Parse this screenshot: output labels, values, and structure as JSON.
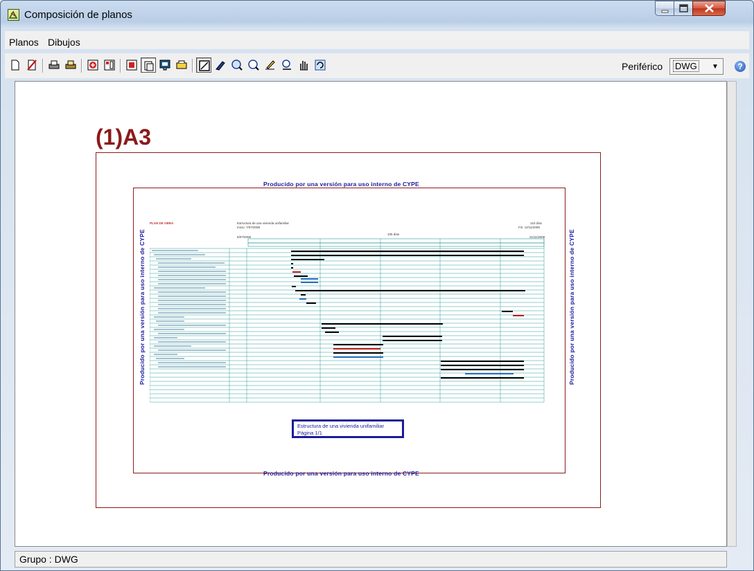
{
  "window": {
    "title": "Composición de planos"
  },
  "menu": {
    "items": [
      "Planos",
      "Dibujos"
    ]
  },
  "toolbar": {
    "buttons": [
      {
        "name": "new-icon"
      },
      {
        "name": "delete-icon"
      },
      {
        "name": "print-icon"
      },
      {
        "name": "print-setup-icon"
      },
      {
        "name": "add-plan-icon"
      },
      {
        "name": "plan-layout-icon"
      },
      {
        "name": "insert-drawing-icon"
      },
      {
        "name": "drawing-list-icon"
      },
      {
        "name": "preview-icon"
      },
      {
        "name": "export-icon"
      },
      {
        "name": "select-icon"
      },
      {
        "name": "edit-icon"
      },
      {
        "name": "zoom-window-icon"
      },
      {
        "name": "zoom-x2-icon"
      },
      {
        "name": "draw-icon"
      },
      {
        "name": "measure-icon"
      },
      {
        "name": "pan-hand-icon"
      },
      {
        "name": "refresh-icon"
      }
    ],
    "peripheral_label": "Periférico",
    "peripheral_value": "DWG",
    "help": "?"
  },
  "sheet": {
    "title": "(1)A3",
    "watermark": "Producido por una versión para uso interno de CYPE",
    "plan_label": "PLAN DE OBRA",
    "header_left": "Estructura de una vivienda unifamiliar",
    "header_start": "Inicio: 7/07/2008",
    "header_days": "110 días",
    "header_end": "Fin: 12/11/2008",
    "timeline_start": "6/07/2008",
    "timeline_mid": "105 días",
    "timeline_end": "21/11/2008",
    "cartouche_line1": "Estructura de una vivienda unifamiliar",
    "cartouche_line2": "Página 1/1"
  },
  "status": {
    "text": "Grupo : DWG"
  },
  "colors": {
    "frame": "#8b1a1a",
    "watermark": "#1b1b9a",
    "grid": "#2a9a9a",
    "bar_black": "#000000",
    "bar_red": "#c01818",
    "bar_blue": "#2a6fc0"
  }
}
